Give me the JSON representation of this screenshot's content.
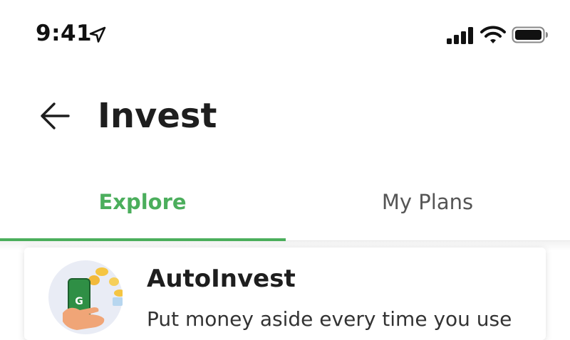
{
  "status_bar": {
    "time": "9:41",
    "icons": [
      "location-arrow-icon",
      "signal-bars-icon",
      "wifi-icon",
      "battery-icon"
    ]
  },
  "header": {
    "back_icon": "back-arrow-icon",
    "title": "Invest"
  },
  "tabs": [
    {
      "label": "Explore",
      "active": true
    },
    {
      "label": "My Plans",
      "active": false
    }
  ],
  "colors": {
    "accent": "#4bae5c",
    "text_primary": "#1e1e1e",
    "text_inactive": "#555555"
  },
  "card": {
    "icon": "autoinvest-phone-coins-icon",
    "title": "AutoInvest",
    "description": "Put money aside every time you use"
  }
}
